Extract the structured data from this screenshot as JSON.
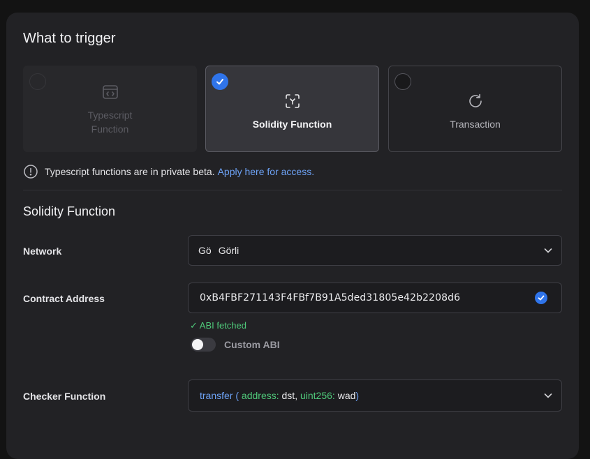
{
  "section": {
    "title": "What to trigger"
  },
  "trigger_options": [
    {
      "label": "Typescript Function",
      "selected": false,
      "disabled": true,
      "icon": "code-window-icon"
    },
    {
      "label": "Solidity Function",
      "selected": true,
      "disabled": false,
      "icon": "solidity-icon"
    },
    {
      "label": "Transaction",
      "selected": false,
      "disabled": false,
      "icon": "refresh-icon"
    }
  ],
  "notice": {
    "text": "Typescript functions are in private beta.",
    "link": "Apply here for access."
  },
  "solidity": {
    "title": "Solidity Function",
    "network": {
      "label": "Network",
      "abbr": "Gö",
      "value": "Görli"
    },
    "contract": {
      "label": "Contract Address",
      "value": "0xB4FBF271143F4FBf7B91A5ded31805e42b2208d6",
      "status": "✓ ABI fetched"
    },
    "custom_abi": {
      "label": "Custom ABI",
      "enabled": false
    },
    "checker": {
      "label": "Checker Function",
      "fn": "transfer",
      "open": " ( ",
      "p1_type": "address:",
      "p1_name": " dst, ",
      "p2_type": "uint256:",
      "p2_name": " wad",
      "close": ")"
    }
  },
  "colors": {
    "accent": "#2f74ea",
    "success": "#4fc97a",
    "link": "#6da2f5",
    "panel": "#222225"
  }
}
